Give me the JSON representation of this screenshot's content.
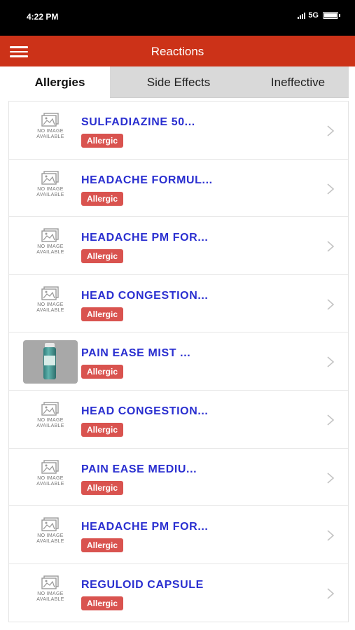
{
  "status_bar": {
    "time": "4:22 PM",
    "network": "5G"
  },
  "header": {
    "title": "Reactions"
  },
  "tabs": [
    {
      "label": "Allergies",
      "active": true
    },
    {
      "label": "Side Effects",
      "active": false
    },
    {
      "label": "Ineffective",
      "active": false
    }
  ],
  "placeholder": {
    "line1": "NO IMAGE",
    "line2": "AVAILABLE"
  },
  "items": [
    {
      "title": "SULFADIAZINE 50...",
      "badge": "Allergic",
      "has_image": false
    },
    {
      "title": "HEADACHE FORMUL...",
      "badge": "Allergic",
      "has_image": false
    },
    {
      "title": "HEADACHE PM FOR...",
      "badge": "Allergic",
      "has_image": false
    },
    {
      "title": "HEAD CONGESTION...",
      "badge": "Allergic",
      "has_image": false
    },
    {
      "title": "PAIN EASE MIST ...",
      "badge": "Allergic",
      "has_image": true
    },
    {
      "title": "HEAD CONGESTION...",
      "badge": "Allergic",
      "has_image": false
    },
    {
      "title": "PAIN EASE MEDIU...",
      "badge": "Allergic",
      "has_image": false
    },
    {
      "title": "HEADACHE PM FOR...",
      "badge": "Allergic",
      "has_image": false
    },
    {
      "title": "REGULOID CAPSULE",
      "badge": "Allergic",
      "has_image": false
    }
  ],
  "colors": {
    "header": "#cc3218",
    "title": "#2a2fd0",
    "badge": "#d9534f"
  }
}
